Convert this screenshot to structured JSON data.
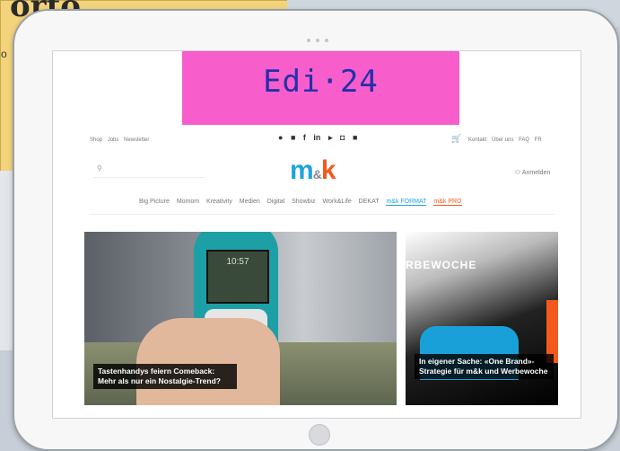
{
  "background": {
    "card_title": "orto",
    "card_sub": "o"
  },
  "banner": {
    "text": "Edi·24",
    "color": "#f75ecc"
  },
  "header": {
    "top_links": [
      "Shop",
      "Jobs",
      "Newsletter"
    ],
    "social_icons": [
      "●",
      "■",
      "f",
      "in",
      "▸",
      "◘",
      "■"
    ],
    "cart_icon": "🛒",
    "right_links": [
      "Kontakt",
      "Über uns",
      "FAQ",
      "FR"
    ],
    "login": "Anmelden",
    "search_icon": "⚲"
  },
  "logo": {
    "m": "m",
    "amp": "&",
    "k": "k"
  },
  "nav": {
    "items": [
      "Big Picture",
      "Momom",
      "Kreativity",
      "Medien",
      "Digital",
      "Showbiz",
      "Work&Life",
      "DEKAT"
    ],
    "format": "m&k FORMAT",
    "pro": "m&k PRO"
  },
  "articles": [
    {
      "caption": "Tastenhandys feiern Comeback: Mehr als nur ein Nostalgie-Trend?",
      "phone_time": "10:57"
    },
    {
      "caption": "In eigener Sache: «One Brand»-Strategie für m&k und Werbewoche",
      "kicker": "RBEWOCHE"
    }
  ]
}
